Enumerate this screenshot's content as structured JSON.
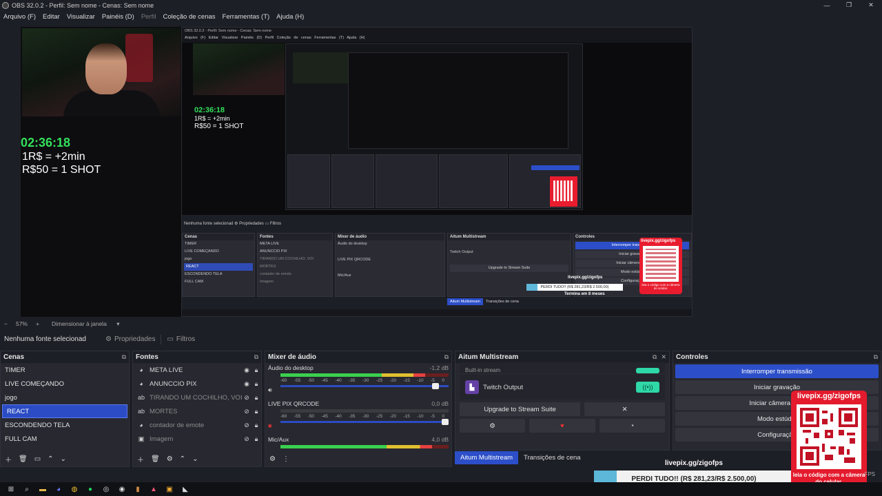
{
  "window": {
    "title": "OBS 32.0.2 - Perfil: Sem nome - Cenas: Sem nome",
    "controls": [
      "—",
      "❐",
      "✕"
    ]
  },
  "menu": [
    "Arquivo (F)",
    "Editar",
    "Visualizar",
    "Painéis (D)",
    "Perfil",
    "Coleção de cenas",
    "Ferramentas (T)",
    "Ajuda (H)"
  ],
  "preview": {
    "timer": "02:36:18",
    "rule1": "1R$ = +2min",
    "rule2": "R$50 = 1 SHOT",
    "nested_title": "OBS 32.0.2 - Perfil: Sem nome - Cenas: Sem nome",
    "nested_menu": "Arquivo (F)  Editar  Visualizar  Painéis (D)  Perfil  Coleção de cenas  Ferramentas (T)  Ajuda (H)",
    "nested_nosel": "Nenhuma fonte selecionad",
    "nested_props": "Propriedades",
    "nested_filters": "Filtros",
    "nested_zoom": "57%  Dimensionar à janela"
  },
  "zoom": {
    "minus": "−",
    "value": "57%",
    "plus": "+",
    "mode": "Dimensionar à janela"
  },
  "props_bar": {
    "nosel": "Nenhuma fonte selecionad",
    "properties": "Propriedades",
    "filters": "Filtros"
  },
  "scenes": {
    "title": "Cenas",
    "items": [
      "TIMER",
      "LIVE COMEÇANDO",
      "jogo",
      "REACT",
      "ESCONDENDO TELA",
      "FULL CAM"
    ],
    "selected": "REACT"
  },
  "sources": {
    "title": "Fontes",
    "items": [
      {
        "name": "META LIVE",
        "icon": "globe-icon",
        "visible": true
      },
      {
        "name": "ANUNCCIO PIX",
        "icon": "globe-icon",
        "visible": true
      },
      {
        "name": "TIRANDO UM COCHILHO, VOI",
        "icon": "text-icon",
        "visible": false
      },
      {
        "name": "MORTES",
        "icon": "text-icon",
        "visible": false
      },
      {
        "name": "contador de emote",
        "icon": "globe-icon",
        "visible": false
      },
      {
        "name": "Imagem",
        "icon": "image-icon",
        "visible": false
      }
    ]
  },
  "mixer": {
    "title": "Mixer de áudio",
    "channels": [
      {
        "name": "Áudio do desktop",
        "db": "-1,2 dB",
        "level": 0.86
      },
      {
        "name": "LIVE PIX QRCODE",
        "db": "0,0 dB",
        "level": 0
      },
      {
        "name": "Mic/Aux",
        "db": "4,0 dB",
        "level": 0.9
      }
    ],
    "scale": [
      "-60",
      "-55",
      "-50",
      "-45",
      "-40",
      "-35",
      "-30",
      "-25",
      "-20",
      "-15",
      "-10",
      "-5",
      "0"
    ]
  },
  "multistream": {
    "title": "Aitum Multistream",
    "partial_label": "Built-in stream",
    "output": "Twitch Output",
    "upgrade": "Upgrade to Stream Suite",
    "close_x": "✕"
  },
  "tabs": {
    "active": "Aitum Multistream",
    "other": "Transições de cena"
  },
  "controls": {
    "title": "Controles",
    "stop_stream": "Interromper transmissão",
    "start_record": "Iniciar gravação",
    "virtual_cam": "Iniciar câmera virtu",
    "studio_mode": "Modo estúdio",
    "settings": "Configuração"
  },
  "donation": {
    "url": "livepix.gg/zigofps",
    "bar_text": "PERDI TUDO!! (R$ 281,23/R$ 2.500,00)",
    "progress": 0.1125,
    "footer": "Termina em 8 meses"
  },
  "qr": {
    "label": "livepix.gg/zigofps",
    "caption": "leia o código com a câmera do celular."
  },
  "status": {
    "fps": "FPS"
  },
  "colors": {
    "accent": "#2c4fc9",
    "timer_green": "#33e15c",
    "qr_red": "#e41b2d",
    "toggle_green": "#2fd8a8",
    "twitch": "#6441a5"
  }
}
